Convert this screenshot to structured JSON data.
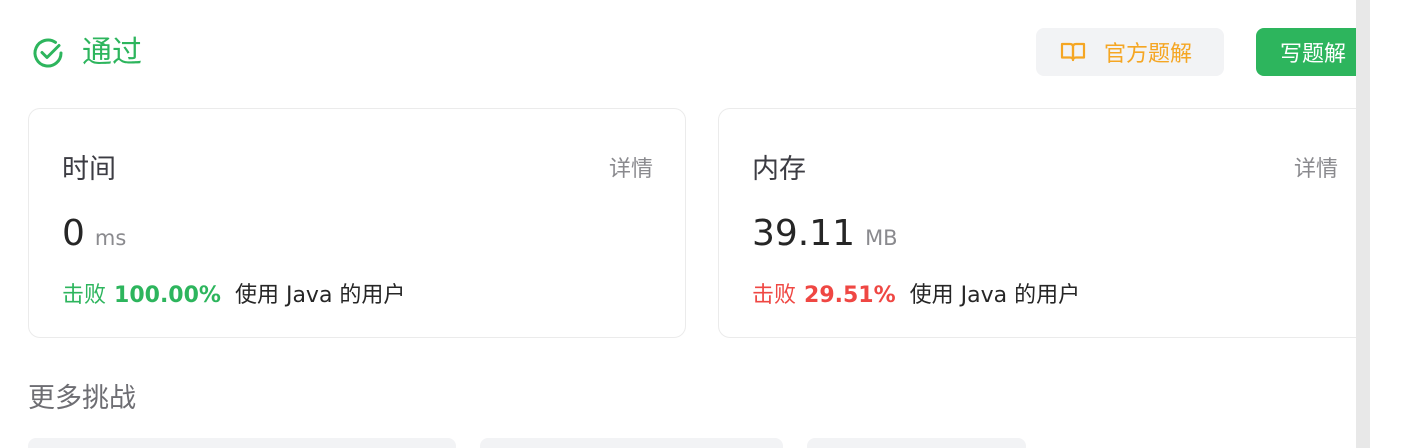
{
  "header": {
    "status_text": "通过",
    "status_icon": "check-circle-icon",
    "solution_button_label": "官方题解",
    "solution_icon": "book-icon",
    "write_button_label": "写题解"
  },
  "colors": {
    "accent_green": "#2db55d",
    "accent_orange": "#f5a623",
    "accent_red": "#ef4743"
  },
  "cards": {
    "time": {
      "title": "时间",
      "detail": "详情",
      "value": "0",
      "unit": "ms",
      "beat_label": "击败",
      "beat_pct": "100.00%",
      "beat_tail": "使用 Java 的用户"
    },
    "memory": {
      "title": "内存",
      "detail": "详情",
      "value": "39.11",
      "unit": "MB",
      "beat_label": "击败",
      "beat_pct": "29.51%",
      "beat_tail": "使用 Java 的用户"
    }
  },
  "more": {
    "title": "更多挑战"
  }
}
